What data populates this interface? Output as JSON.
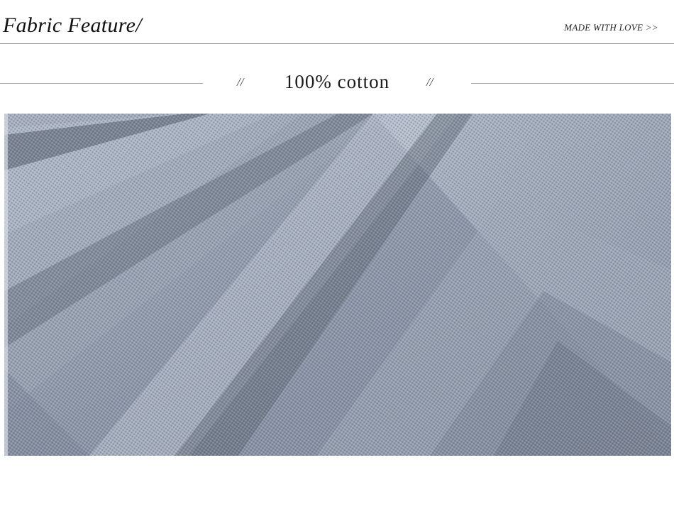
{
  "header": {
    "title": "Fabric Feature/",
    "link_label": "MADE WITH LOVE >>"
  },
  "section": {
    "left_ornament": "//",
    "title": "100% cotton",
    "right_ornament": "//"
  },
  "photo": {
    "subject": "fabric-closeup",
    "base_color": "#8e98aa",
    "highlight_color": "#c2c9d6",
    "shadow_color": "#5d6676"
  }
}
